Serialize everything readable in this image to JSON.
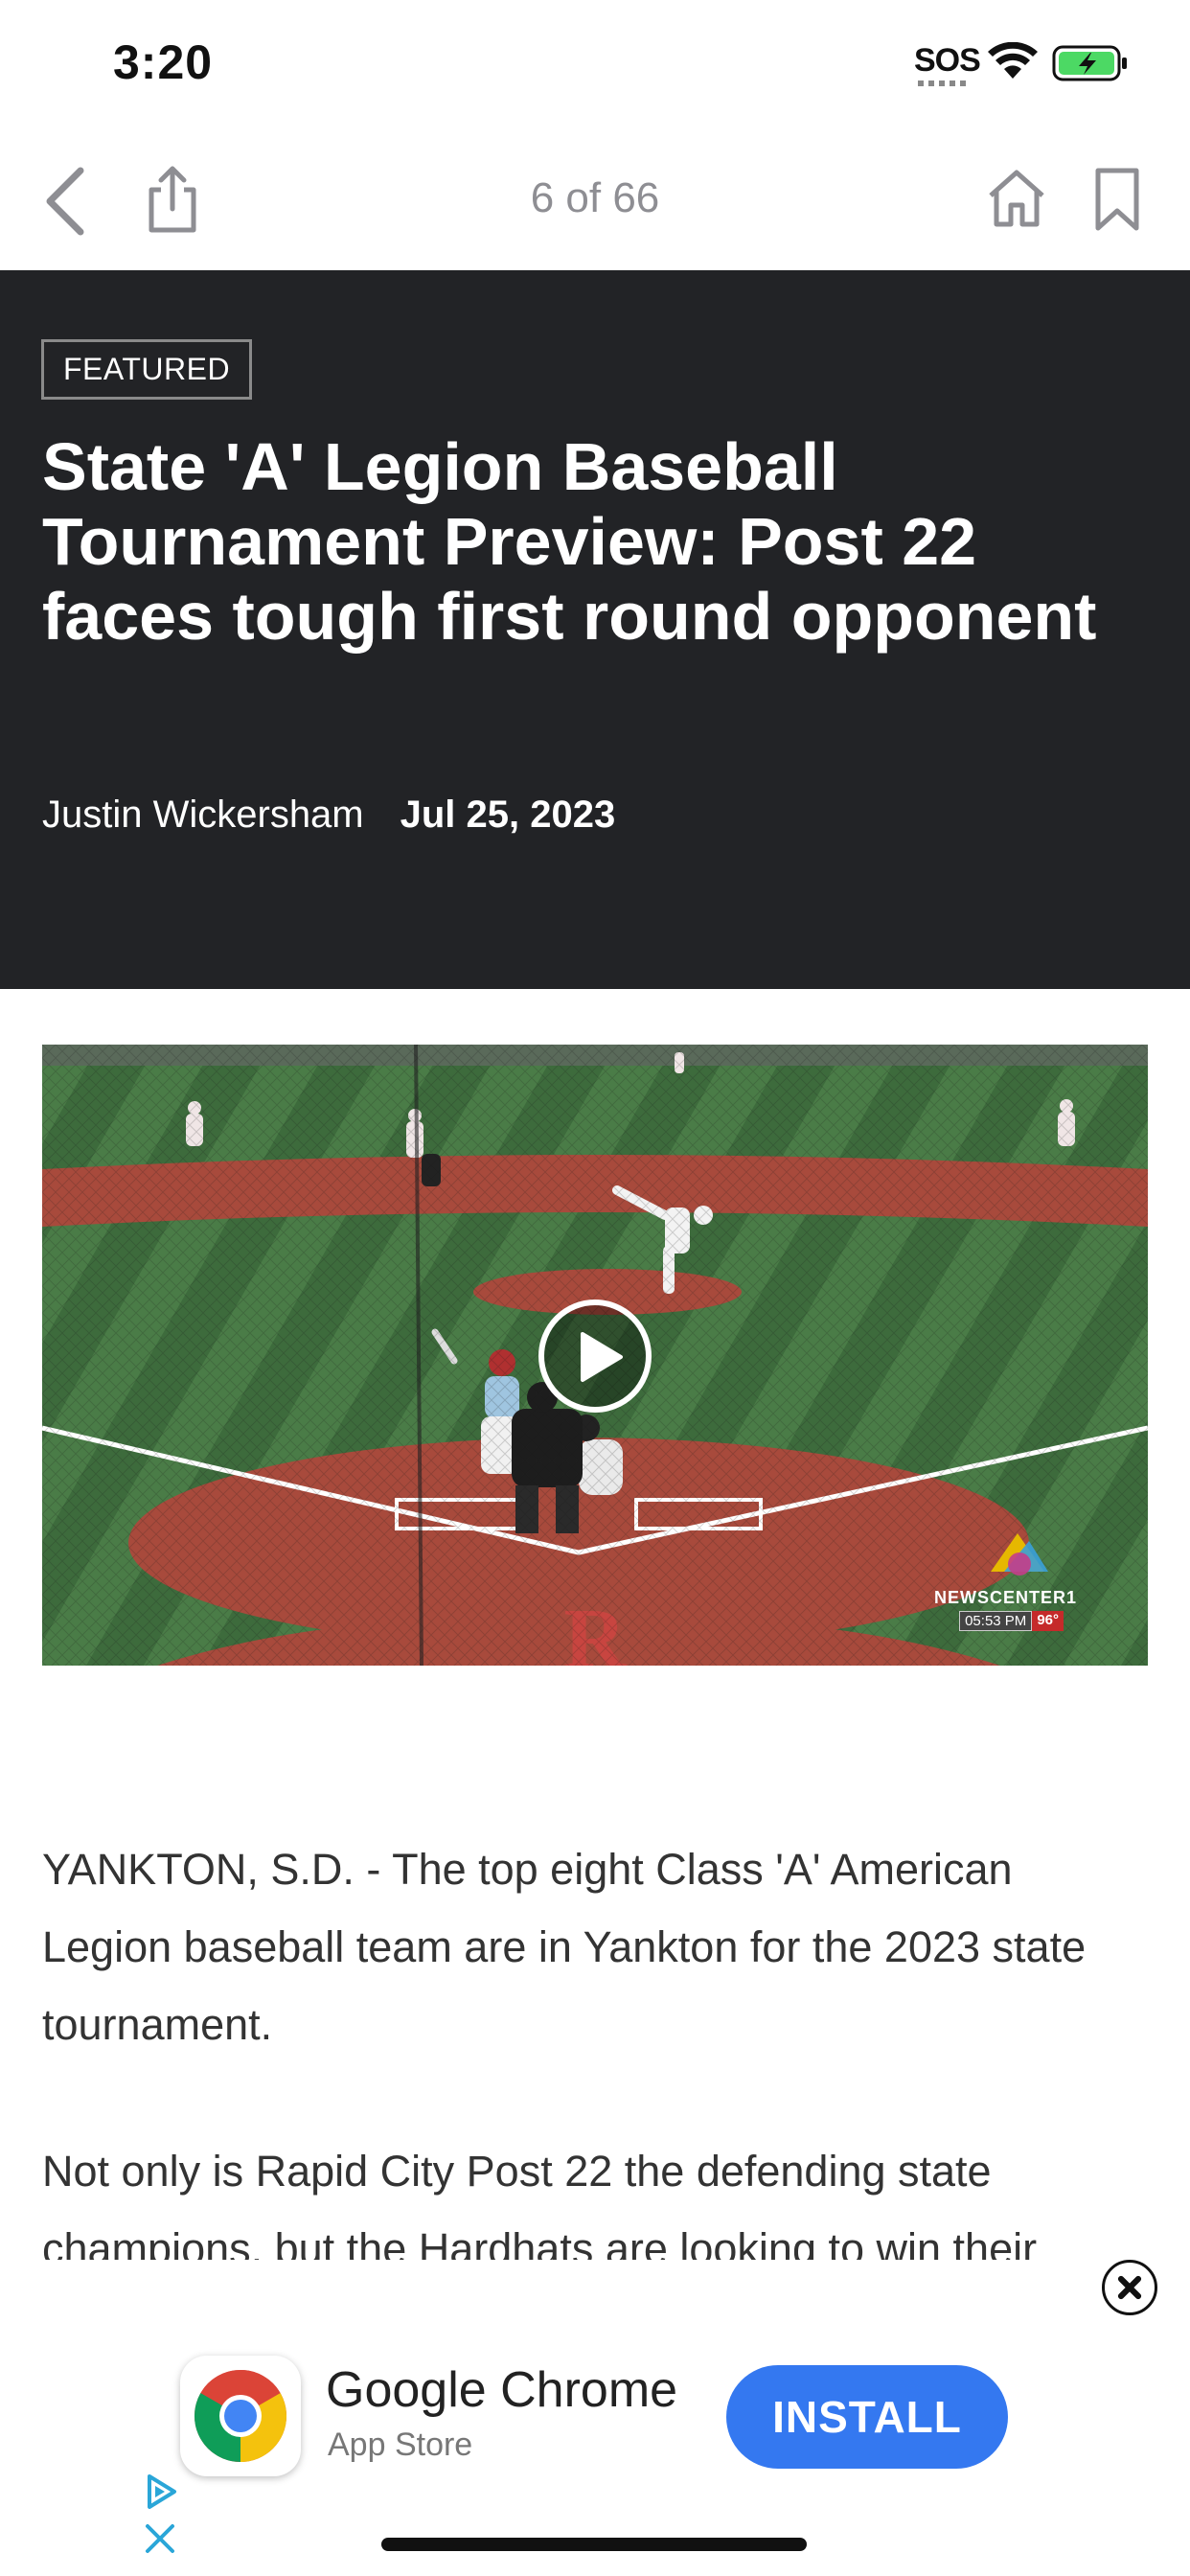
{
  "status_bar": {
    "time": "3:20",
    "sos": "SOS"
  },
  "toolbar": {
    "page_counter": "6 of 66"
  },
  "article": {
    "badge": "FEATURED",
    "headline": "State 'A' Legion Baseball Tournament Preview: Post 22 faces tough first round opponent",
    "author": "Justin Wickersham",
    "date": "Jul 25, 2023",
    "video": {
      "logo_text": "NEWSCENTER1",
      "overlay_time": "05:53 PM",
      "overlay_temp": "96°"
    },
    "paragraphs": [
      "YANKTON, S.D. - The top eight Class 'A' American Legion baseball team are in Yankton for the 2023 state tournament.",
      "Not only is Rapid City Post 22 the defending state champions, but the Hardhats are looking to win their"
    ]
  },
  "ad": {
    "app_name": "Google Chrome",
    "store": "App Store",
    "install_label": "INSTALL"
  },
  "colors": {
    "header_bg": "#222326",
    "install_blue": "#3478f0",
    "battery_green": "#4cd964"
  }
}
